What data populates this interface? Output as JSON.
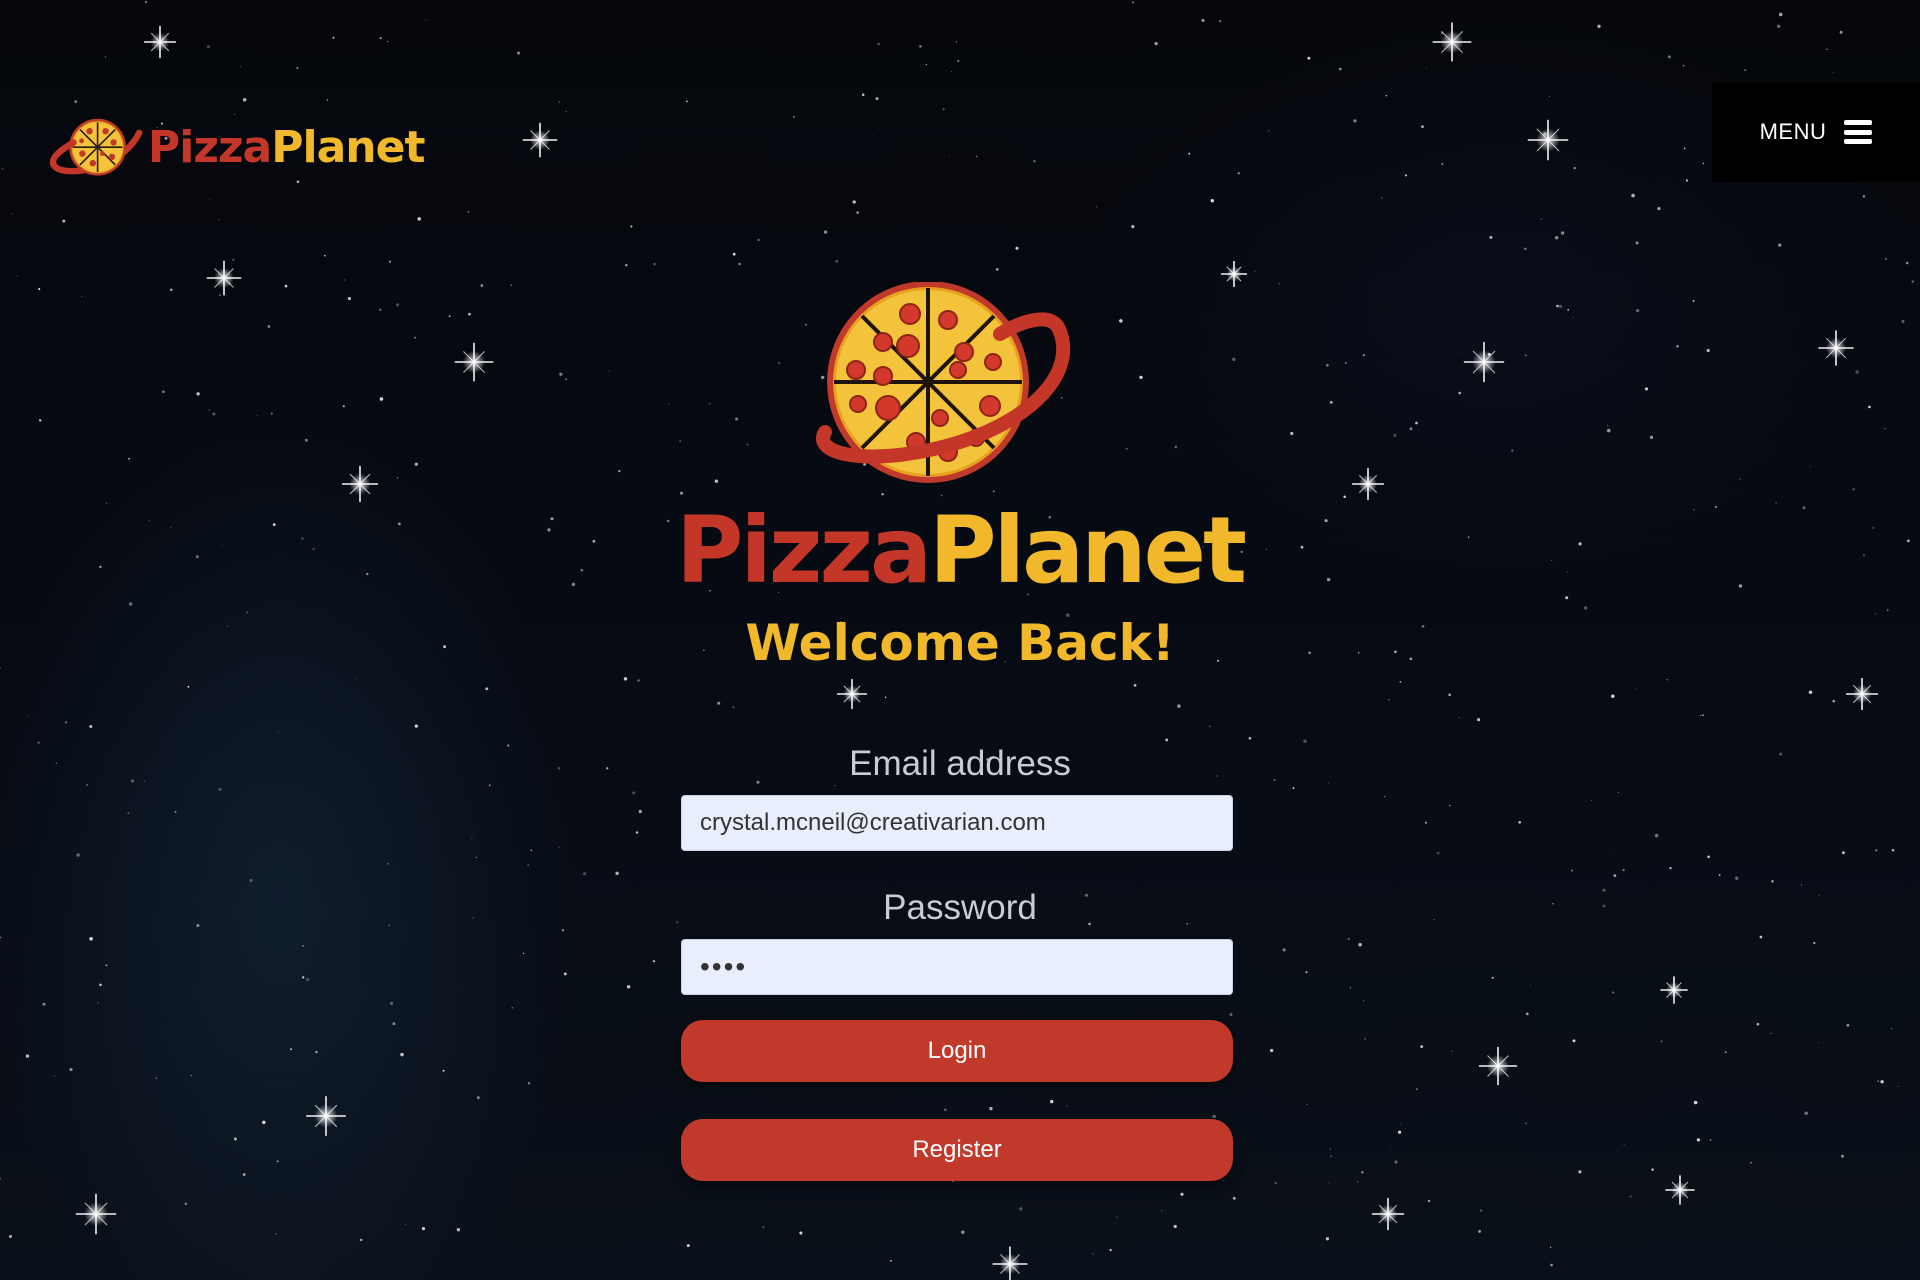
{
  "brand": {
    "name_part1": "Pizza",
    "name_part2": "Planet",
    "colors": {
      "red": "#c43628",
      "yellow": "#f1b82b"
    }
  },
  "header": {
    "menu_label": "MENU",
    "menu_icon": "hamburger-icon"
  },
  "main": {
    "welcome": "Welcome Back!",
    "email": {
      "label": "Email address",
      "value": "crystal.mcneil@creativarian.com"
    },
    "password": {
      "label": "Password",
      "value": "••••"
    },
    "login_label": "Login",
    "register_label": "Register"
  },
  "colors": {
    "background": "#05070d",
    "button": "#c0392b",
    "input_background": "#e8eefb",
    "label": "#c9ccd2"
  }
}
